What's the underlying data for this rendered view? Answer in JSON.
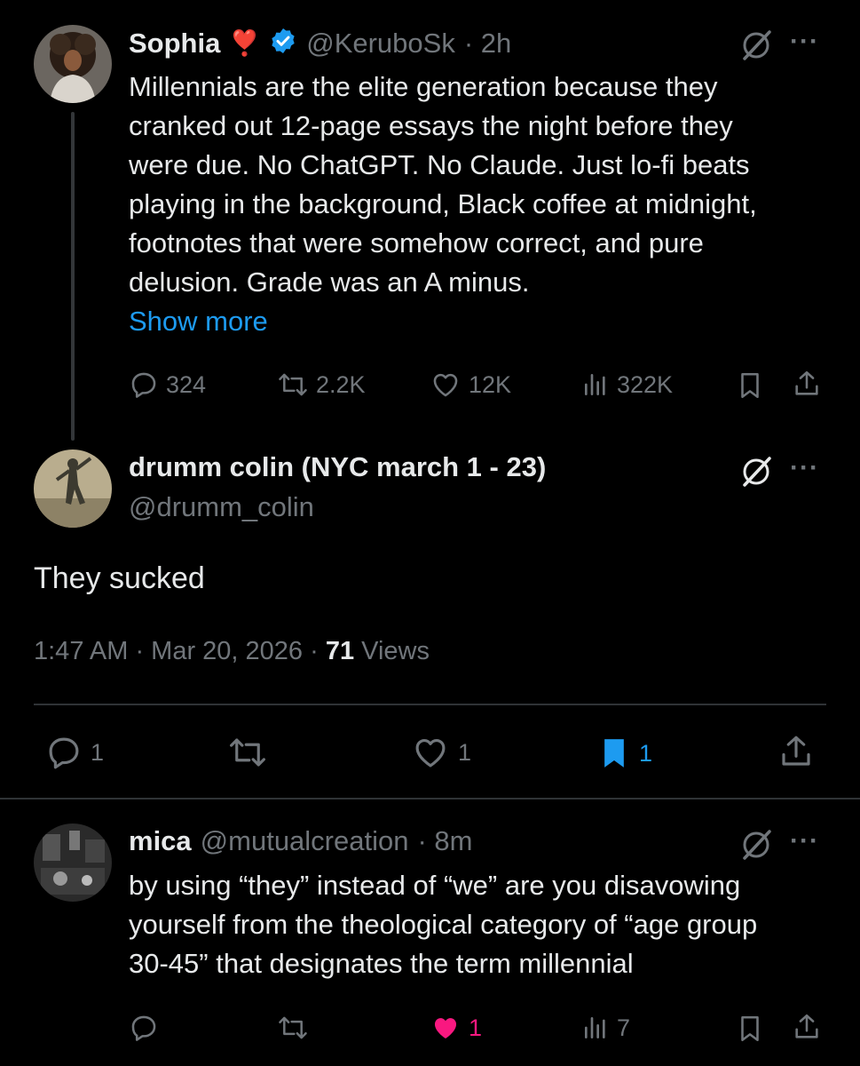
{
  "tweet1": {
    "name": "Sophia",
    "badge_emoji": "❣️",
    "handle": "@KeruboSk",
    "time": "· 2h",
    "lines": [
      "Millennials are the elite generation because they",
      "cranked out 12-page essays the night before they",
      "were due. No ChatGPT. No Claude. Just lo-fi beats",
      "playing in the background, Black coffee at midnight,",
      "footnotes that were somehow correct, and pure",
      "delusion. Grade was an A minus."
    ],
    "show_more": "Show more",
    "replies": "324",
    "retweets": "2.2K",
    "likes": "12K",
    "views": "322K"
  },
  "tweet2": {
    "name": "drumm colin (NYC march 1 - 23)",
    "handle": "@drumm_colin",
    "text": "They sucked",
    "timestamp": "1:47 AM · Mar 20, 2026 · ",
    "views_count": "71",
    "views_label": " Views",
    "replies": "1",
    "likes": "1",
    "bookmarks": "1"
  },
  "tweet3": {
    "name": "mica",
    "handle": "@mutualcreation",
    "time": "· 8m",
    "lines": [
      "by using “they” instead of “we” are you disavowing",
      "yourself from the theological category of “age group",
      "30-45” that designates the term millennial"
    ],
    "likes": "1",
    "views": "7"
  },
  "colors": {
    "background": "#000000",
    "text": "#e7e9ea",
    "muted": "#71767b",
    "link": "#1d9bf0",
    "like_active": "#f91880",
    "bookmark_active": "#1d9bf0",
    "verified": "#1d9bf0"
  },
  "icons": [
    "grok-icon",
    "more-icon",
    "reply-icon",
    "retweet-icon",
    "like-icon",
    "views-icon",
    "bookmark-icon",
    "share-icon",
    "verified-icon"
  ]
}
